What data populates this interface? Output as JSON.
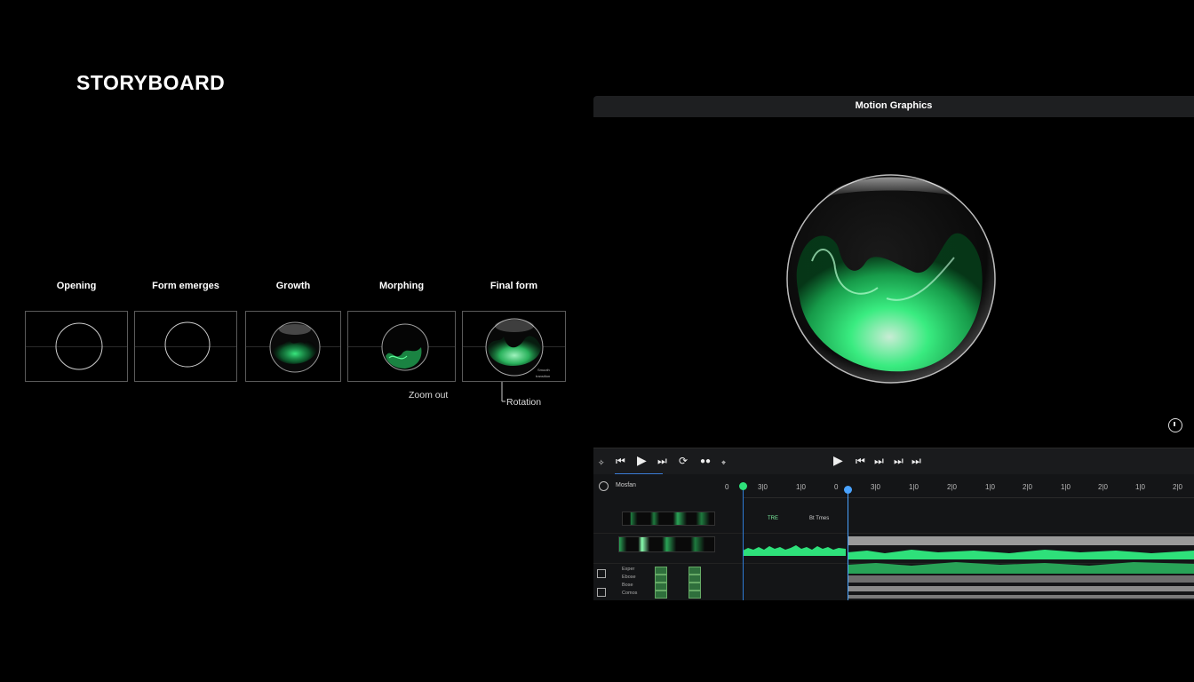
{
  "storyboard": {
    "title": "STORYBOARD",
    "frames": [
      {
        "label": "Opening"
      },
      {
        "label": "Form emerges"
      },
      {
        "label": "Growth"
      },
      {
        "label": "Morphing"
      },
      {
        "label": "Final form"
      }
    ],
    "annotations": {
      "zoom": "Zoom out",
      "rotation": "Rotation"
    },
    "final_frame_text": [
      "Smooth",
      "transition"
    ]
  },
  "panel": {
    "title": "Motion Graphics",
    "accent_color": "#2ee07a",
    "playhead_color": "#4aa3ff"
  },
  "transport": {
    "left_buttons": [
      "tool-icon",
      "skip-back-icon",
      "play-icon",
      "skip-forward-icon",
      "loop-icon",
      "record-icon",
      "pin-icon"
    ],
    "right_buttons": [
      "play-icon",
      "prev-frame-icon",
      "next-frame-icon",
      "skip-end-icon",
      "end-icon"
    ]
  },
  "timeline": {
    "name": "Mosfan",
    "ticks": [
      "0",
      "3|0",
      "1|0",
      "0",
      "3|0",
      "1|0",
      "2|0",
      "1|0",
      "2|0",
      "1|0",
      "2|0",
      "1|0",
      "2|0",
      "3|0"
    ],
    "markers": {
      "first": "TRE",
      "second": "Bt Tmes"
    },
    "properties": [
      {
        "label": "Exper"
      },
      {
        "label": "Ebose"
      },
      {
        "label": "Bose"
      },
      {
        "label": "Comos"
      }
    ]
  }
}
